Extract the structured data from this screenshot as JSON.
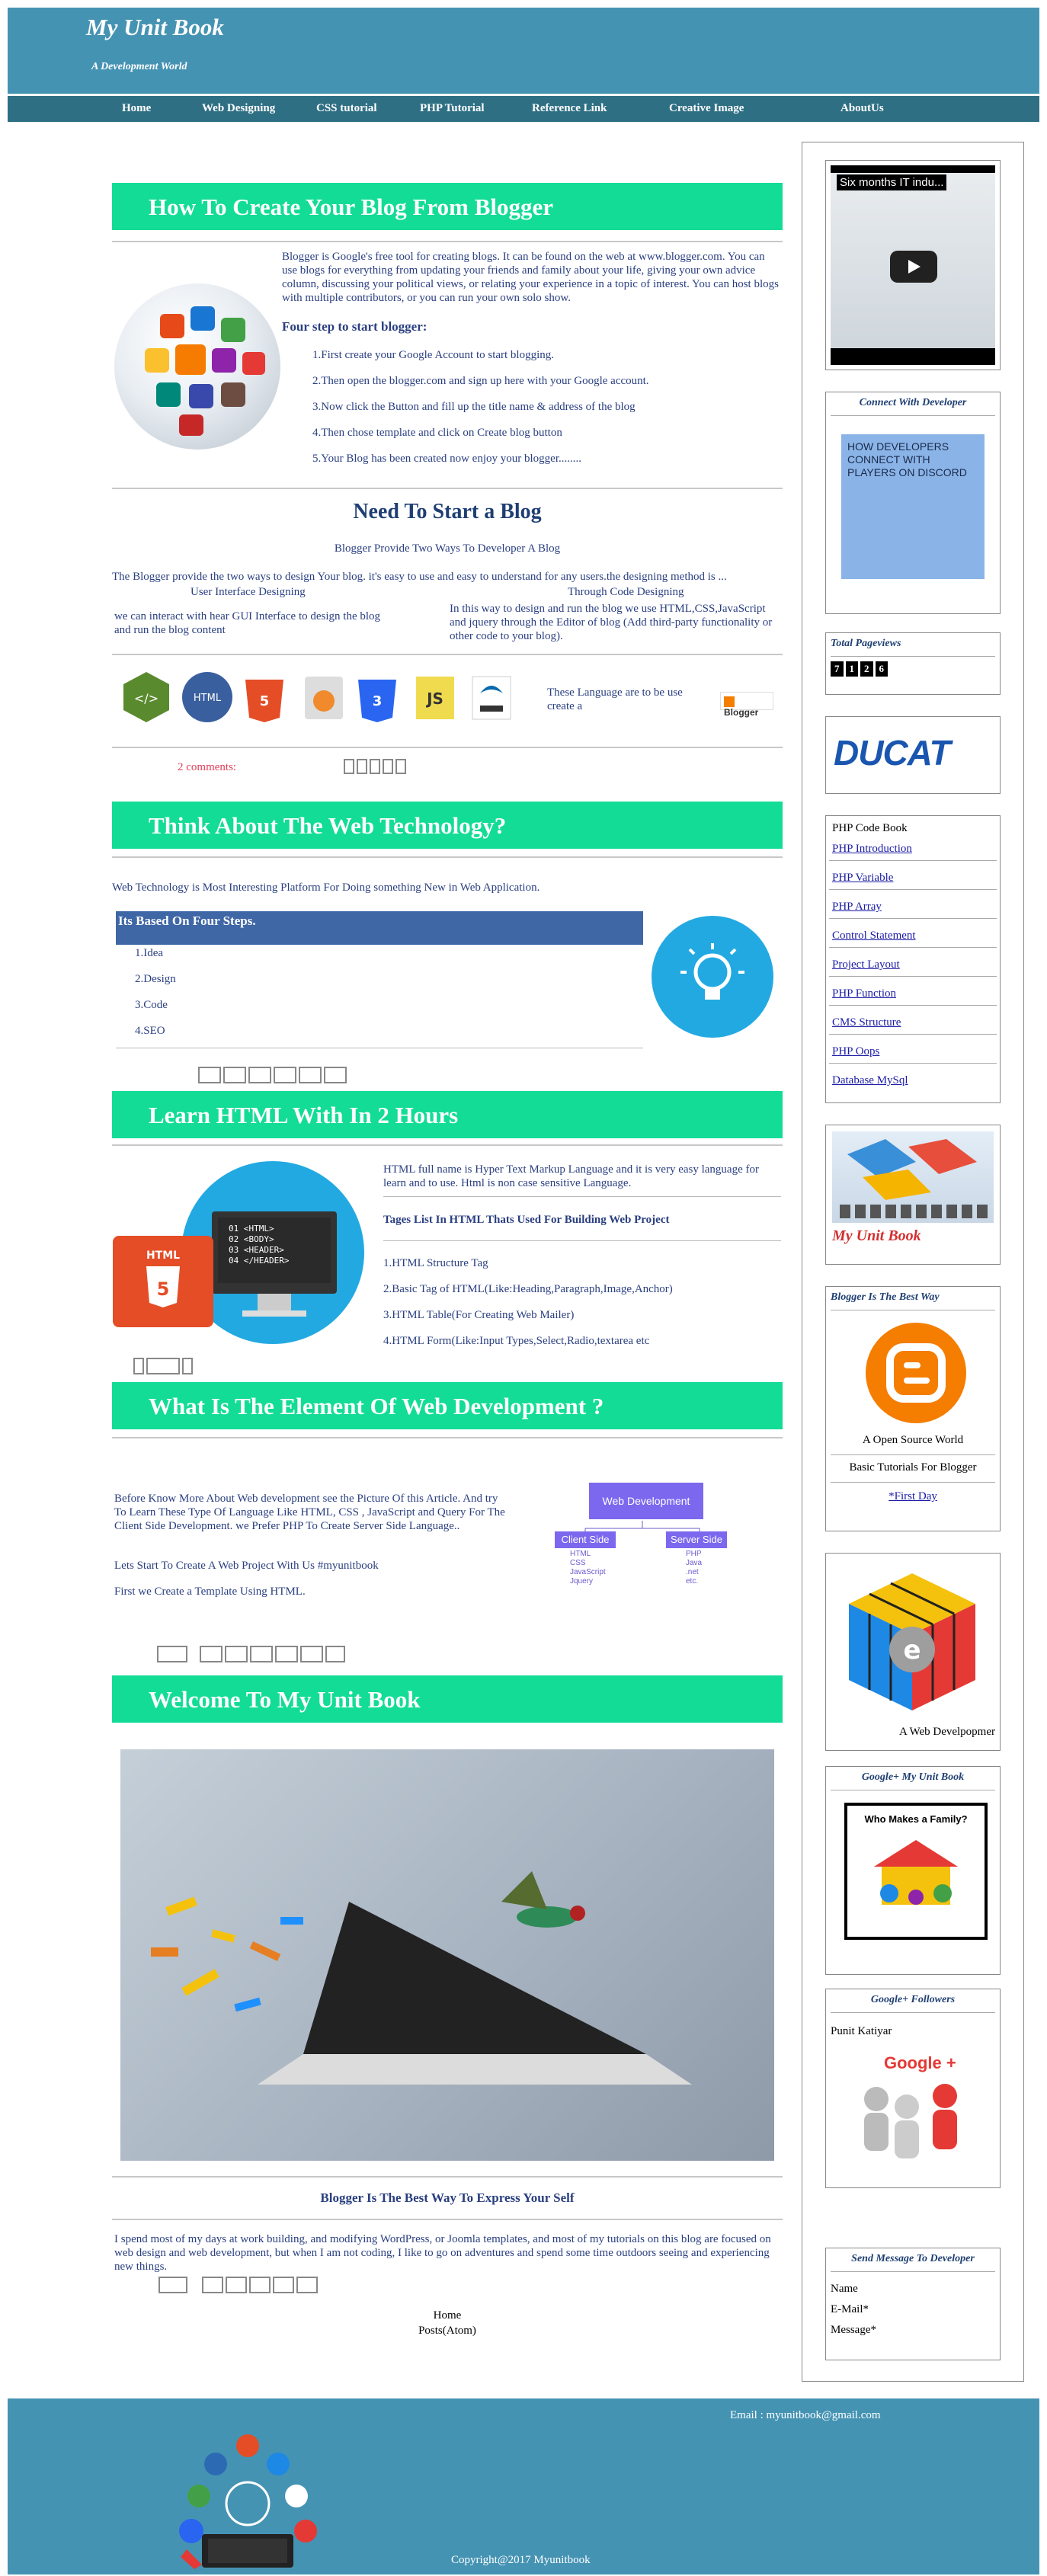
{
  "header": {
    "title": "My Unit Book",
    "subtitle": "A Development World"
  },
  "nav": [
    "Home",
    "Web Designing",
    "CSS tutorial",
    "PHP Tutorial",
    "Reference Link",
    "Creative Image",
    "AboutUs"
  ],
  "post1": {
    "title": "How To Create Your Blog From Blogger",
    "intro": "Blogger is Google's free tool for creating blogs. It can be found on the web at www.blogger.com. You can use blogs for everything from updating your friends and family about your life, giving your own advice column, discussing your political views, or relating your experience in a topic of interest. You can host blogs with multiple contributors, or you can run your own solo show.",
    "steps_title": "Four step to start blogger:",
    "steps": [
      "1.First create your Google Account to start blogging.",
      "2.Then open the blogger.com and sign up here with your Google account.",
      "3.Now click the Button and fill up the title name & address of the blog",
      "4.Then chose template and click on Create blog button",
      "5.Your Blog has been created now enjoy your blogger........"
    ],
    "h2": "Need To Start a Blog",
    "sub": "Blogger Provide Two Ways To Developer A Blog",
    "desc": "The Blogger provide the two ways to design Your blog. it's easy to use and easy to understand for any users.the designing method is ...",
    "col1_title": "User Interface Designing",
    "col1_text": "we can interact with hear GUI Interface to design the blog and run the blog content",
    "col2_title": "Through Code Designing",
    "col2_text": "In this way to design and run the blog we use HTML,CSS,JavaScript and jquery through the Editor of blog (Add third-party functionality or other code to your blog).",
    "lang_note": "These Language are to be use create a",
    "comments": "2 comments:"
  },
  "post2": {
    "title": "Think About The Web Technology?",
    "intro": "Web Technology is Most Interesting Platform For Doing something New in Web Application.",
    "steps_title": "Its Based On Four Steps.",
    "steps": [
      "1.Idea",
      "2.Design",
      "3.Code",
      "4.SEO"
    ]
  },
  "post3": {
    "title": "Learn HTML With In 2 Hours",
    "intro": "HTML full name is Hyper Text Markup Language and it is very easy language for learn and to use. Html is non case sensitive Language.",
    "tags_title": "Tages List In HTML Thats Used For Building Web Project",
    "tags": [
      "1.HTML Structure Tag",
      "2.Basic Tag of HTML(Like:Heading,Paragraph,Image,Anchor)",
      "3.HTML Table(For Creating Web Mailer)",
      "4.HTML Form(Like:Input Types,Select,Radio,textarea etc"
    ],
    "code": [
      "01 <HTML>",
      "02 <BODY>",
      "03 <HEADER>",
      "04 </HEADER>"
    ]
  },
  "post4": {
    "title": "What Is The Element Of Web Development ?",
    "p1": "Before Know More About Web development see the Picture Of this Article. And try To Learn These Type Of Language Like HTML, CSS , JavaScript and Query For The Client Side Development. we Prefer PHP To Create Server Side Language..",
    "p2": "Lets Start To Create A Web Project With Us #myunitbook",
    "p3": "First we Create a Template Using HTML.",
    "diagram": {
      "root": "Web Development",
      "left": "Client Side",
      "right": "Server Side",
      "left_items": [
        "HTML",
        "CSS",
        "JavaScript",
        "Jquery"
      ],
      "right_items": [
        "PHP",
        "Java",
        ".net",
        "etc."
      ]
    }
  },
  "post5": {
    "title": "Welcome To My Unit Book",
    "subtitle": "Blogger Is The Best Way To Express Your Self",
    "text": "I spend most of my days at work building, and modifying WordPress, or Joomla templates, and most of my tutorials on this blog are focused on web design and web development, but when I am not coding, I like to go on adventures and spend some time outdoors seeing and experiencing new things."
  },
  "footer_nav": {
    "home": "Home",
    "posts": "Posts(Atom)"
  },
  "sidebar": {
    "video_title": "Six months IT indu...",
    "connect_title": "Connect With Developer",
    "connect_img": "HOW DEVELOPERS CONNECT WITH PLAYERS ON DISCORD",
    "pageviews_title": "Total Pageviews",
    "pageviews": [
      "7",
      "1",
      "2",
      "6"
    ],
    "ducat": "DUCAT",
    "php_title": "PHP Code Book",
    "php_links": [
      "PHP Introduction",
      "PHP Variable",
      "PHP Array",
      "Control Statement",
      "Project Layout",
      "PHP Function",
      "CMS Structure",
      "PHP Oops",
      "Database MySql"
    ],
    "brand": "My Unit Book",
    "blogger_title": "Blogger Is The Best Way",
    "blogger_cap": "A Open Source World",
    "blogger_text": "Basic Tutorials For Blogger",
    "first_day": "*First Day",
    "cube_cap": "A Web Develpopmer",
    "gplus_title": "Google+ My Unit Book",
    "gplus_card": "Who Makes a Family?",
    "followers_title": "Google+ Followers",
    "follower": "Punit Katiyar",
    "gplus_logo": "Google +",
    "contact_title": "Send Message To Developer",
    "contact_fields": [
      "Name",
      "E-Mail*",
      "Message*"
    ]
  },
  "footer": {
    "email": "Email : myunitbook@gmail.com",
    "copyright": "Copyright@2017 Myunitbook"
  },
  "colors": {
    "header": "#4593b3",
    "nav": "#2f6f84",
    "band": "#13dc97",
    "text": "#2a3f80"
  }
}
